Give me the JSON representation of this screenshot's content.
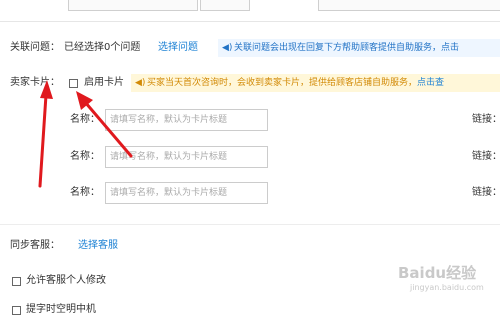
{
  "related_issues": {
    "label": "关联问题：",
    "status": "已经选择0个问题",
    "select_link": "选择问题",
    "note": "关联问题会出现在回复下方帮助顾客提供自助服务，点击"
  },
  "seller_card": {
    "label": "卖家卡片：",
    "enable_label": "启用卡片",
    "enabled": false,
    "note": "买家当天首次咨询时，会收到卖家卡片，提供给顾客店铺自助服务，",
    "note_link": "点击查",
    "rows": [
      {
        "name_label": "名称：",
        "placeholder": "请填写名称，默认为卡片标题",
        "link_label": "链接："
      },
      {
        "name_label": "名称：",
        "placeholder": "请填写名称，默认为卡片标题",
        "link_label": "链接："
      },
      {
        "name_label": "名称：",
        "placeholder": "请填写名称，默认为卡片标题",
        "link_label": "链接："
      }
    ]
  },
  "sync_service": {
    "label": "同步客服：",
    "link": "选择客服"
  },
  "options": {
    "allow_personal_edit": "允许客服个人修改",
    "partial_bottom": "提字时空明中机"
  },
  "watermark": {
    "brand": "Baidu经验",
    "url": "jingyan.baidu.com"
  },
  "colors": {
    "link": "#1e82d4",
    "note_blue_bg": "#eef6ff",
    "note_yellow_bg": "#fff7d9",
    "note_yellow_text": "#d28a06",
    "arrow": "#e0191e"
  }
}
